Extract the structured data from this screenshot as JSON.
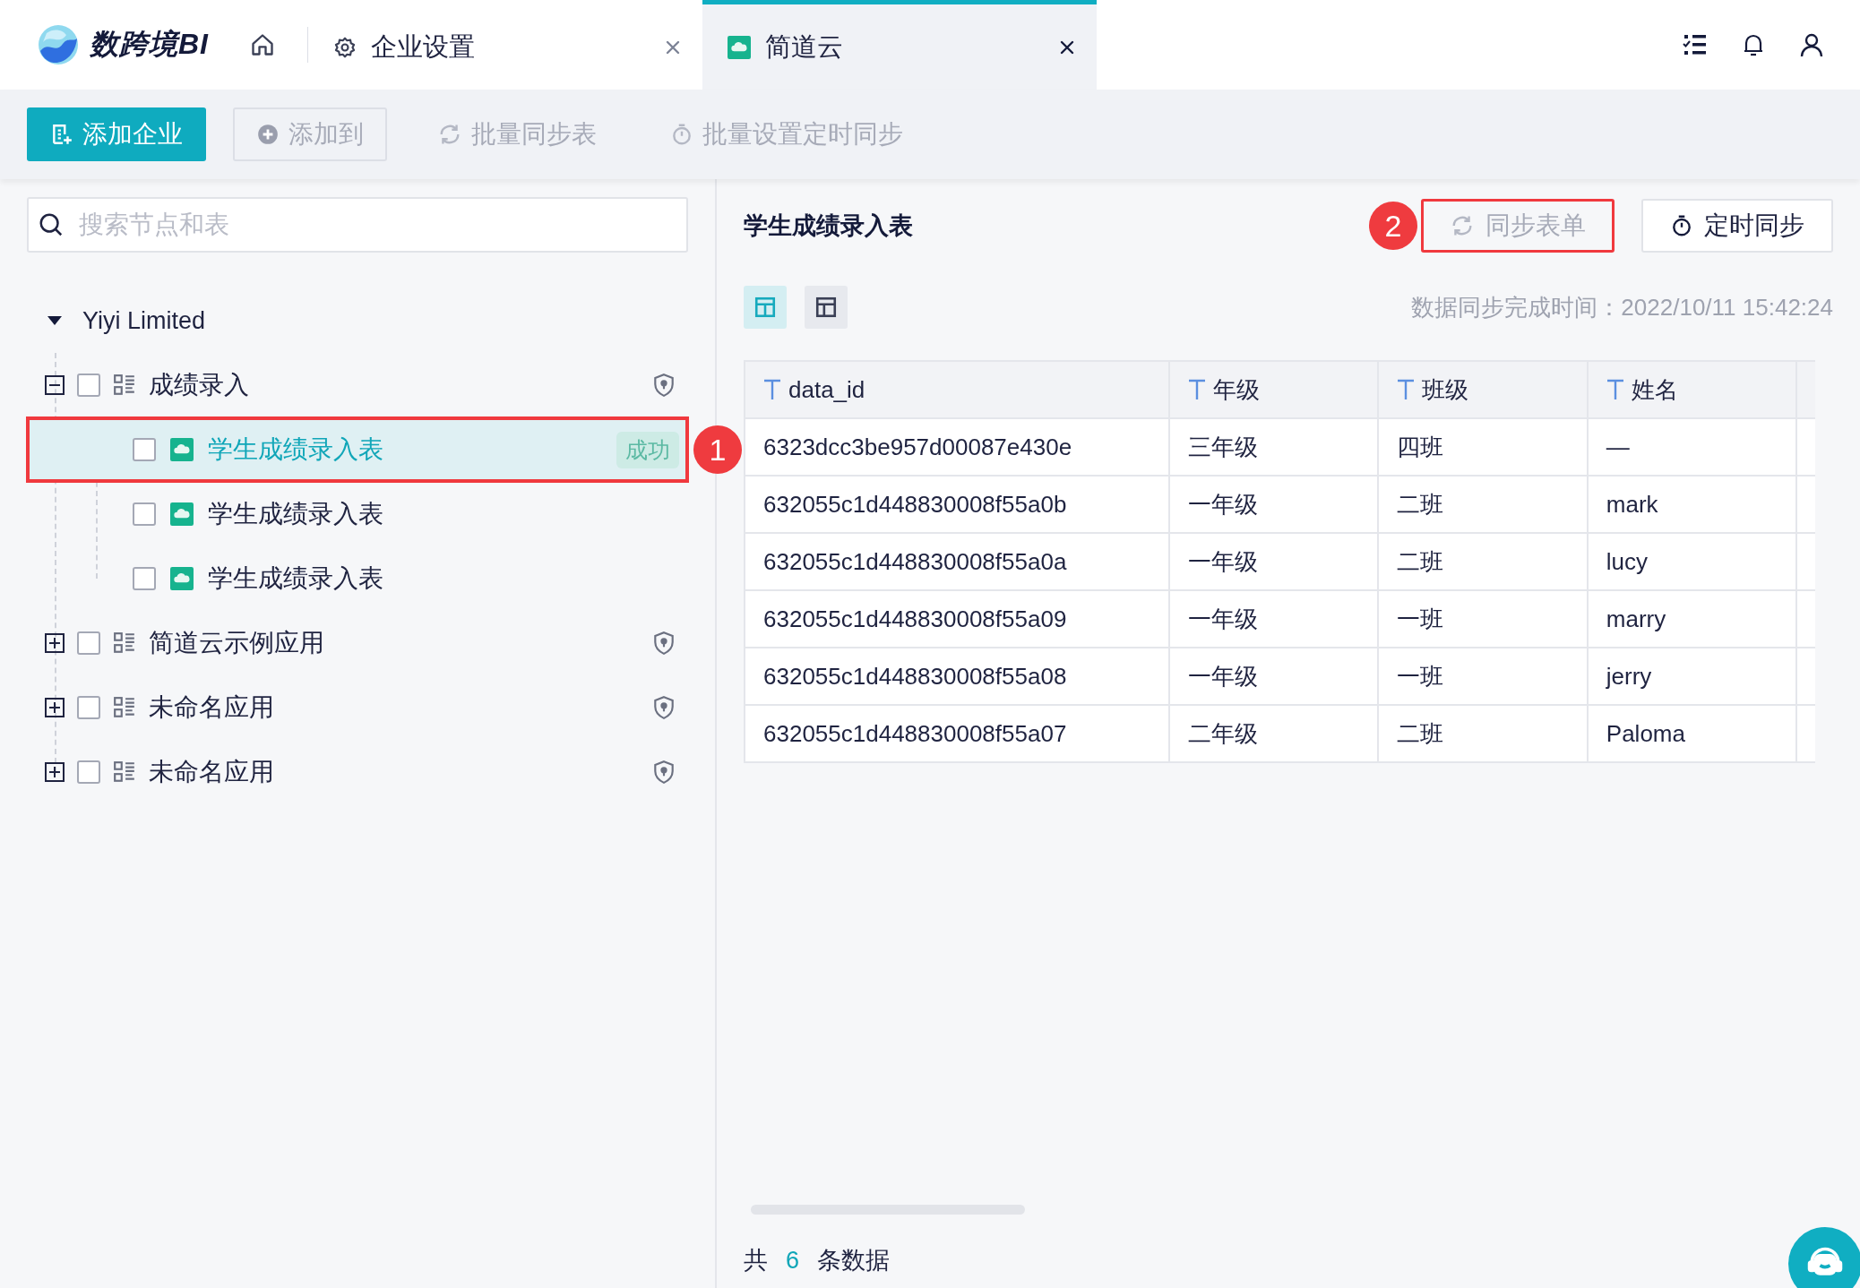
{
  "header": {
    "logo_text": "数跨境BI",
    "tabs": [
      {
        "kind": "home",
        "selected": false
      },
      {
        "kind": "settings",
        "label": "企业设置",
        "selected": false
      },
      {
        "kind": "cloud",
        "label": "简道云",
        "selected": true
      }
    ]
  },
  "toolbar": [
    {
      "kind": "primary",
      "label": "添加企业",
      "disabled": false
    },
    {
      "kind": "add",
      "label": "添加到",
      "disabled": true
    },
    {
      "kind": "sync",
      "label": "批量同步表",
      "disabled": true
    },
    {
      "kind": "timer",
      "label": "批量设置定时同步",
      "disabled": true
    }
  ],
  "sidebar": {
    "search": {
      "placeholder": "搜索节点和表"
    },
    "tree": {
      "label": "Yiyi Limited",
      "expanded": true,
      "children": [
        {
          "kind": "app",
          "label": "成绩录入",
          "expanded": true,
          "checked": false,
          "children": [
            {
              "kind": "table",
              "label": "学生成绩录入表",
              "checked": false,
              "selected": true,
              "status": "成功",
              "callout": "1"
            },
            {
              "kind": "table",
              "label": "学生成绩录入表",
              "checked": false,
              "selected": false
            },
            {
              "kind": "table",
              "label": "学生成绩录入表",
              "checked": false,
              "selected": false
            }
          ]
        },
        {
          "kind": "app",
          "label": "简道云示例应用",
          "expanded": false,
          "checked": false
        },
        {
          "kind": "app",
          "label": "未命名应用",
          "expanded": false,
          "checked": false
        },
        {
          "kind": "app",
          "label": "未命名应用",
          "expanded": false,
          "checked": false
        }
      ]
    }
  },
  "detail": {
    "title": "学生成绩录入表",
    "actions": [
      {
        "kind": "sync",
        "label": "同步表单",
        "disabled": true,
        "callout": "2"
      },
      {
        "kind": "timer",
        "label": "定时同步",
        "disabled": false
      }
    ],
    "views": [
      {
        "kind": "data",
        "selected": true
      },
      {
        "kind": "layout",
        "selected": false
      }
    ],
    "sync_time": "数据同步完成时间：2022/10/11 15:42:24",
    "table": {
      "columns": [
        "data_id",
        "年级",
        "班级",
        "姓名"
      ],
      "rows": [
        [
          "6323dcc3be957d00087e430e",
          "三年级",
          "四班",
          "—"
        ],
        [
          "632055c1d448830008f55a0b",
          "一年级",
          "二班",
          "mark"
        ],
        [
          "632055c1d448830008f55a0a",
          "一年级",
          "二班",
          "lucy"
        ],
        [
          "632055c1d448830008f55a09",
          "一年级",
          "一班",
          "marry"
        ],
        [
          "632055c1d448830008f55a08",
          "一年级",
          "一班",
          "jerry"
        ],
        [
          "632055c1d448830008f55a07",
          "二年级",
          "二班",
          "Paloma"
        ]
      ]
    },
    "footer": {
      "prefix": "共",
      "count": "6",
      "suffix": "条数据"
    }
  }
}
